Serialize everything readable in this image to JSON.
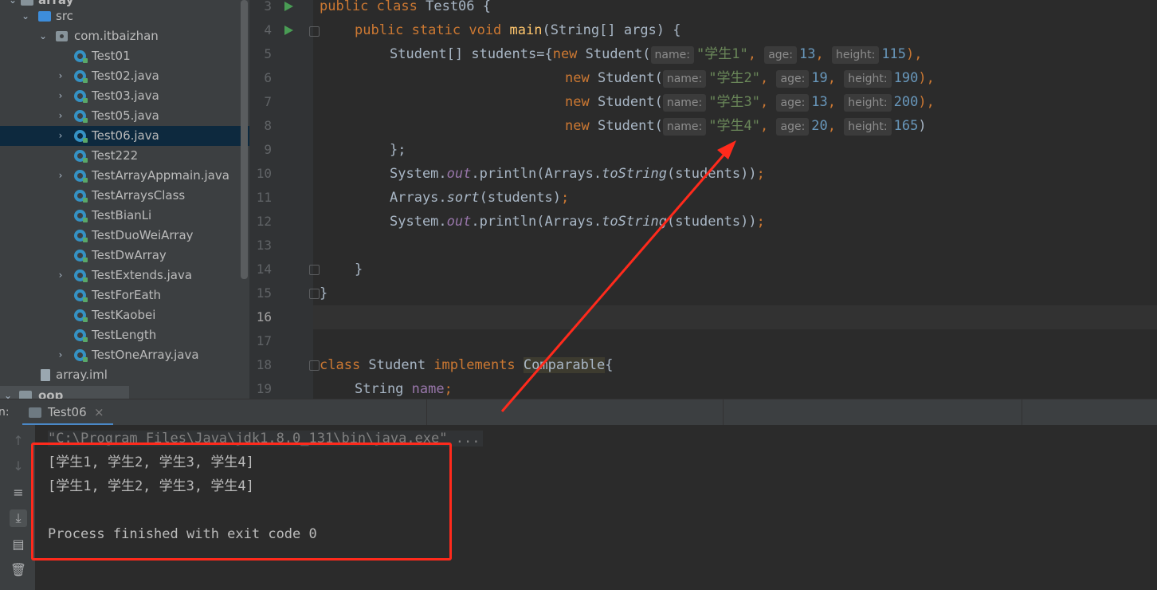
{
  "project_tree": {
    "items": [
      {
        "label": "array",
        "kind": "module",
        "indent": 0,
        "expanded": true
      },
      {
        "label": "src",
        "kind": "source-folder",
        "indent": 1,
        "expanded": true
      },
      {
        "label": "com.itbaizhan",
        "kind": "package",
        "indent": 2,
        "expanded": true
      },
      {
        "label": "Test01",
        "kind": "class",
        "indent": 3
      },
      {
        "label": "Test02.java",
        "kind": "class",
        "indent": 3,
        "collapsible": true
      },
      {
        "label": "Test03.java",
        "kind": "class",
        "indent": 3,
        "collapsible": true
      },
      {
        "label": "Test05.java",
        "kind": "class",
        "indent": 3,
        "collapsible": true
      },
      {
        "label": "Test06.java",
        "kind": "class",
        "indent": 3,
        "collapsible": true,
        "selected": true
      },
      {
        "label": "Test222",
        "kind": "class",
        "indent": 3
      },
      {
        "label": "TestArrayAppmain.java",
        "kind": "class",
        "indent": 3,
        "collapsible": true
      },
      {
        "label": "TestArraysClass",
        "kind": "class",
        "indent": 3
      },
      {
        "label": "TestBianLi",
        "kind": "class",
        "indent": 3
      },
      {
        "label": "TestDuoWeiArray",
        "kind": "class",
        "indent": 3
      },
      {
        "label": "TestDwArray",
        "kind": "class",
        "indent": 3
      },
      {
        "label": "TestExtends.java",
        "kind": "class",
        "indent": 3,
        "collapsible": true
      },
      {
        "label": "TestForEath",
        "kind": "class",
        "indent": 3
      },
      {
        "label": "TestKaobei",
        "kind": "class",
        "indent": 3
      },
      {
        "label": "TestLength",
        "kind": "class",
        "indent": 3
      },
      {
        "label": "TestOneArray.java",
        "kind": "class",
        "indent": 3,
        "collapsible": true
      },
      {
        "label": "array.iml",
        "kind": "iml",
        "indent": 1
      },
      {
        "label": "oop",
        "kind": "module",
        "indent": 0,
        "expanded": true
      }
    ]
  },
  "editor": {
    "current_line": "16",
    "lines": [
      {
        "n": "3",
        "run": true,
        "fold": false
      },
      {
        "n": "4",
        "run": true,
        "fold": true
      },
      {
        "n": "5"
      },
      {
        "n": "6"
      },
      {
        "n": "7"
      },
      {
        "n": "8"
      },
      {
        "n": "9"
      },
      {
        "n": "10"
      },
      {
        "n": "11"
      },
      {
        "n": "12"
      },
      {
        "n": "13"
      },
      {
        "n": "14",
        "fold": true
      },
      {
        "n": "15",
        "fold": true
      },
      {
        "n": "16"
      },
      {
        "n": "17"
      },
      {
        "n": "18",
        "fold": true
      },
      {
        "n": "19"
      }
    ],
    "code": {
      "l3": {
        "kw1": "public",
        "kw2": "class",
        "name": "Test06",
        "brace": " {"
      },
      "l4": {
        "kw1": "public",
        "kw2": "static",
        "kw3": "void",
        "fn": "main",
        "rest": "(String[] args) {"
      },
      "l5": {
        "pre": "Student[] students={",
        "new": "new",
        "ctor": " Student(",
        "hint_name": "name:",
        "s": "\"学生1\"",
        "hint_age": "age:",
        "age": "13",
        "hint_height": "height:",
        "height": "115",
        "end": "),"
      },
      "l6": {
        "new": "new",
        "ctor": " Student(",
        "hint_name": "name:",
        "s": "\"学生2\"",
        "hint_age": "age:",
        "age": "19",
        "hint_height": "height:",
        "height": "190",
        "end": "),"
      },
      "l7": {
        "new": "new",
        "ctor": " Student(",
        "hint_name": "name:",
        "s": "\"学生3\"",
        "hint_age": "age:",
        "age": "13",
        "hint_height": "height:",
        "height": "200",
        "end": "),"
      },
      "l8": {
        "new": "new",
        "ctor": " Student(",
        "hint_name": "name:",
        "s": "\"学生4\"",
        "hint_age": "age:",
        "age": "20",
        "hint_height": "height:",
        "height": "165",
        "end": ")"
      },
      "l9": {
        "text": "};"
      },
      "l10": {
        "a": "System.",
        "out": "out",
        "b": ".println(Arrays.",
        "ts": "toString",
        "c": "(students))",
        "semi": ";"
      },
      "l11": {
        "a": "Arrays.",
        "sort": "sort",
        "b": "(students)",
        "semi": ";"
      },
      "l12": {
        "a": "System.",
        "out": "out",
        "b": ".println(Arrays.",
        "ts": "toString",
        "c": "(students))",
        "semi": ";"
      },
      "l14": {
        "text": "}"
      },
      "l15": {
        "text": "}"
      },
      "l18": {
        "kw1": "class",
        "name": " Student ",
        "kw2": "implements",
        "iface": "Comparable",
        "brace": "{"
      },
      "l19": {
        "type": "String ",
        "field": "name",
        "semi": ";"
      }
    }
  },
  "run_panel": {
    "label": "n:",
    "tab": {
      "name": "Test06",
      "close": "×"
    },
    "toolbar_icons": [
      "up-arrow-icon",
      "down-arrow-icon",
      "soft-wrap-icon",
      "scroll-to-end-icon",
      "print-icon",
      "trash-icon"
    ],
    "console": {
      "command": "\"C:\\Program Files\\Java\\jdk1.8.0_131\\bin\\java.exe\" ...",
      "output1": "[学生1, 学生2, 学生3, 学生4]",
      "output2": "[学生1, 学生2, 学生3, 学生4]",
      "blank": "",
      "finished": "Process finished with exit code 0"
    }
  },
  "colors": {
    "annotation_red": "#ff2a1c",
    "selection": "#0d293e",
    "keyword": "#cc7832",
    "string": "#6a8759",
    "number": "#6897bb"
  }
}
